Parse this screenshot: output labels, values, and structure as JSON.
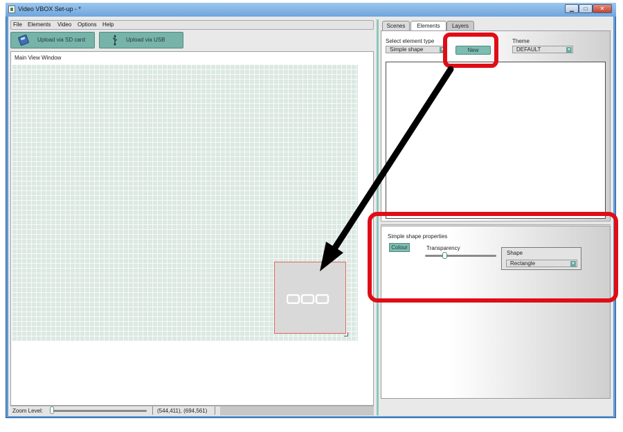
{
  "window": {
    "title": "Video VBOX Set-up - *",
    "controls": [
      "minimize",
      "maximize",
      "close"
    ]
  },
  "menu": {
    "items": [
      "File",
      "Elements",
      "Video",
      "Options",
      "Help"
    ]
  },
  "toolbar": {
    "upload_sd": "Upload via SD card",
    "upload_usb": "Upload via USB"
  },
  "main_view": {
    "label": "Main View Window",
    "element_icon": "shape-element-icon"
  },
  "status": {
    "zoom_label": "Zoom Level:",
    "zoom_value": 0.02,
    "coordinates": "(544,411), (694,561)"
  },
  "tabs": [
    "Scenes",
    "Elements",
    "Layers"
  ],
  "active_tab": "Elements",
  "elements_panel": {
    "select_label": "Select element type",
    "selected_type": "Simple shape",
    "new_button": "New",
    "theme_label": "Theme",
    "theme_value": "DEFAULT"
  },
  "properties": {
    "title": "Simple shape properties",
    "colour_button": "Colour",
    "transparency_label": "Transparency",
    "transparency_value": 0.27,
    "shape_label": "Shape",
    "shape_value": "Rectangle"
  },
  "annotations": {
    "highlight_color": "#e00d16",
    "arrow_color": "#000000"
  },
  "colors": {
    "accent": "#7dbcb1",
    "grid": "#dbe9e2",
    "title_bar": "#6fa5dd"
  }
}
